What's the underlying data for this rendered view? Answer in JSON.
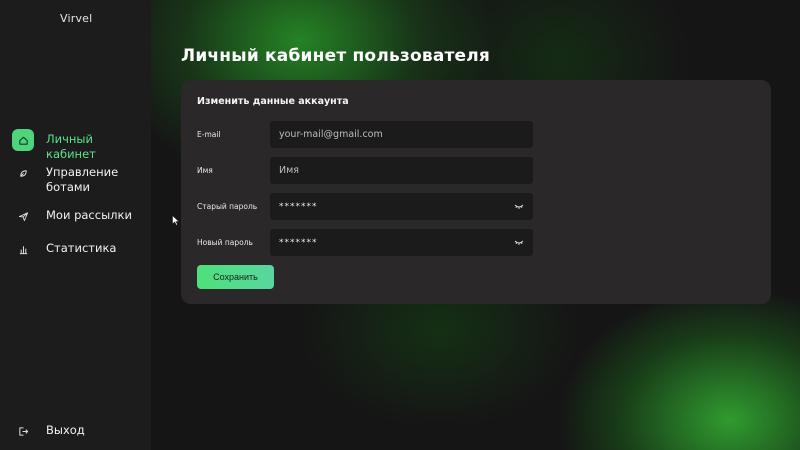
{
  "brand": "Virvel",
  "sidebar": {
    "items": [
      {
        "label": "Личный кабинет",
        "icon": "home-icon",
        "active": true
      },
      {
        "label": "Управление ботами",
        "icon": "leaf-icon",
        "active": false
      },
      {
        "label": "Мои рассылки",
        "icon": "send-icon",
        "active": false
      },
      {
        "label": "Статистика",
        "icon": "bar-chart-icon",
        "active": false
      }
    ],
    "logout": {
      "label": "Выход",
      "icon": "logout-icon"
    }
  },
  "page": {
    "title": "Личный кабинет пользователя"
  },
  "form": {
    "title": "Изменить данные аккаунта",
    "email": {
      "label": "E-mail",
      "placeholder": "your-mail@gmail.com"
    },
    "name": {
      "label": "Имя",
      "placeholder": "Имя"
    },
    "old_password": {
      "label": "Старый пароль",
      "value": "*******"
    },
    "new_password": {
      "label": "Новый пароль",
      "value": "*******"
    },
    "save_label": "Сохранить"
  },
  "colors": {
    "accent": "#4ed47a",
    "sidebar_bg": "#1c1c1c",
    "card_bg": "#2a2829",
    "field_bg": "#1b1b1b"
  }
}
